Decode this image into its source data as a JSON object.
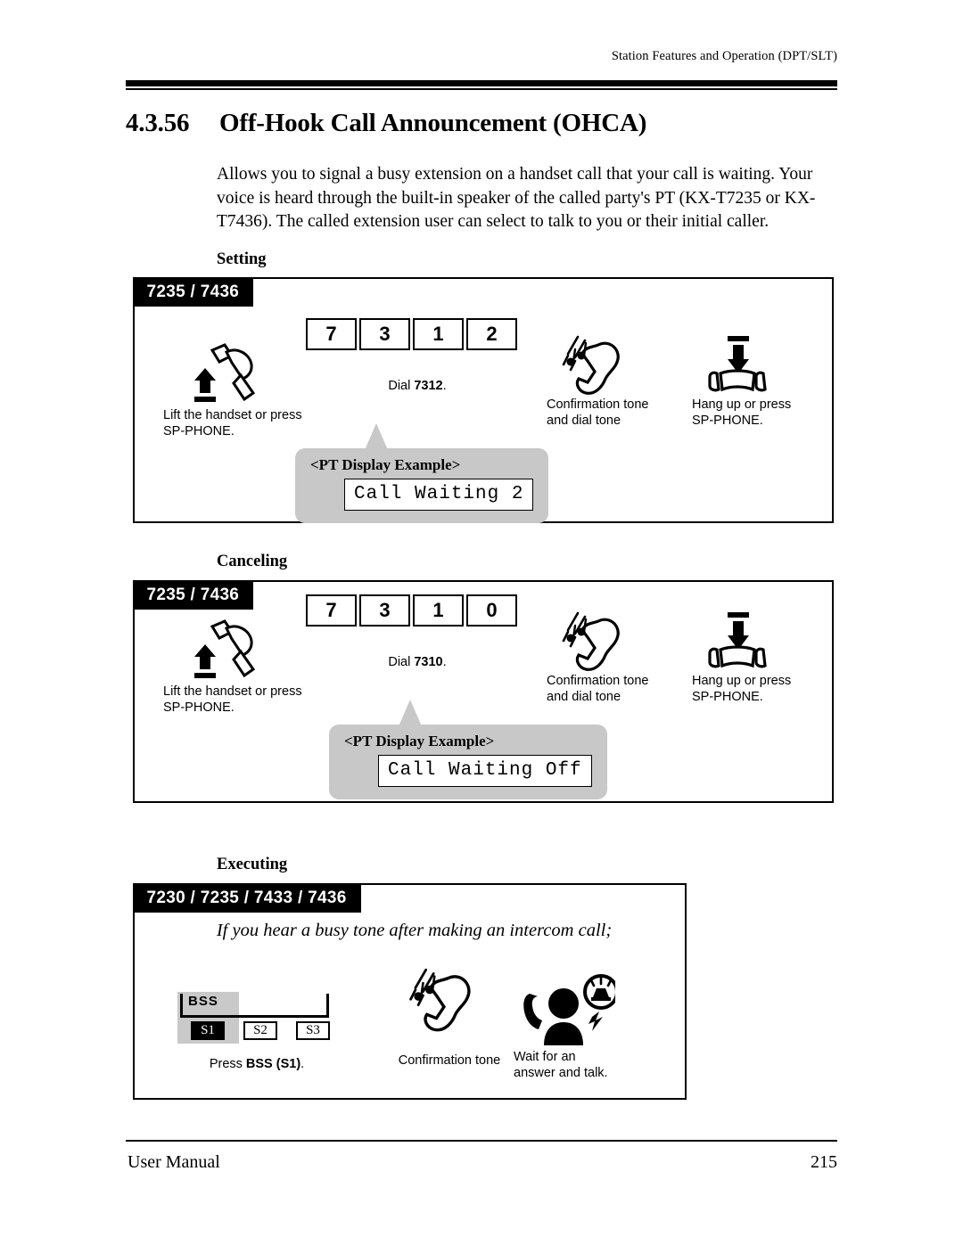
{
  "header": {
    "running_head": "Station Features and Operation (DPT/SLT)"
  },
  "title": {
    "number": "4.3.56",
    "text": "Off-Hook Call Announcement (OHCA)"
  },
  "intro": "Allows you to signal a busy extension on a handset call that your call is waiting. Your voice is heard through the built-in speaker of the called party's PT (KX-T7235 or KX-T7436). The called extension user can select to talk to you or their initial caller.",
  "sections": {
    "setting": {
      "heading": "Setting",
      "models": "7235 / 7436",
      "steps": {
        "lift": {
          "icon": "lift-handset-icon",
          "caption": "Lift the handset or press\nSP-PHONE."
        },
        "dial": {
          "keys": [
            "7",
            "3",
            "1",
            "2"
          ],
          "caption_prefix": "Dial ",
          "caption_code": "7312",
          "caption_suffix": "."
        },
        "tone": {
          "icon": "confirmation-tone-icon",
          "caption": "Confirmation tone\nand dial tone"
        },
        "hangup": {
          "icon": "hang-up-icon",
          "caption": "Hang up or press\nSP-PHONE."
        }
      },
      "callout": {
        "title": "<PT Display Example>",
        "lcd_text": "Call Waiting 2"
      }
    },
    "canceling": {
      "heading": "Canceling",
      "models": "7235 / 7436",
      "steps": {
        "lift": {
          "icon": "lift-handset-icon",
          "caption": "Lift the handset or press\nSP-PHONE."
        },
        "dial": {
          "keys": [
            "7",
            "3",
            "1",
            "0"
          ],
          "caption_prefix": "Dial ",
          "caption_code": "7310",
          "caption_suffix": "."
        },
        "tone": {
          "icon": "confirmation-tone-icon",
          "caption": "Confirmation tone\nand dial tone"
        },
        "hangup": {
          "icon": "hang-up-icon",
          "caption": "Hang up or press\nSP-PHONE."
        }
      },
      "callout": {
        "title": "<PT Display Example>",
        "lcd_text": "Call Waiting Off"
      }
    },
    "executing": {
      "heading": "Executing",
      "models": "7230 / 7235 / 7433 / 7436",
      "note": "If you hear a busy tone after making an intercom call;",
      "steps": {
        "press": {
          "softkey_label": "BSS",
          "softkeys": [
            "S1",
            "S2",
            "S3"
          ],
          "active_softkey": "S1",
          "caption_prefix": "Press ",
          "caption_bold": "BSS (S1)",
          "caption_suffix": "."
        },
        "tone": {
          "icon": "confirmation-tone-icon",
          "caption": "Confirmation tone"
        },
        "wait": {
          "icon": "person-answer-icon",
          "caption": "Wait for an\nanswer and talk."
        }
      }
    }
  },
  "footer": {
    "left": "User Manual",
    "page": "215"
  },
  "colors": {
    "banner_bg": "#000000",
    "banner_text": "#ffffff",
    "callout_bg": "#c8c8c8",
    "softkey_highlight": "#c9c9c9",
    "page_bg": "#ffffff",
    "ink": "#000000"
  }
}
